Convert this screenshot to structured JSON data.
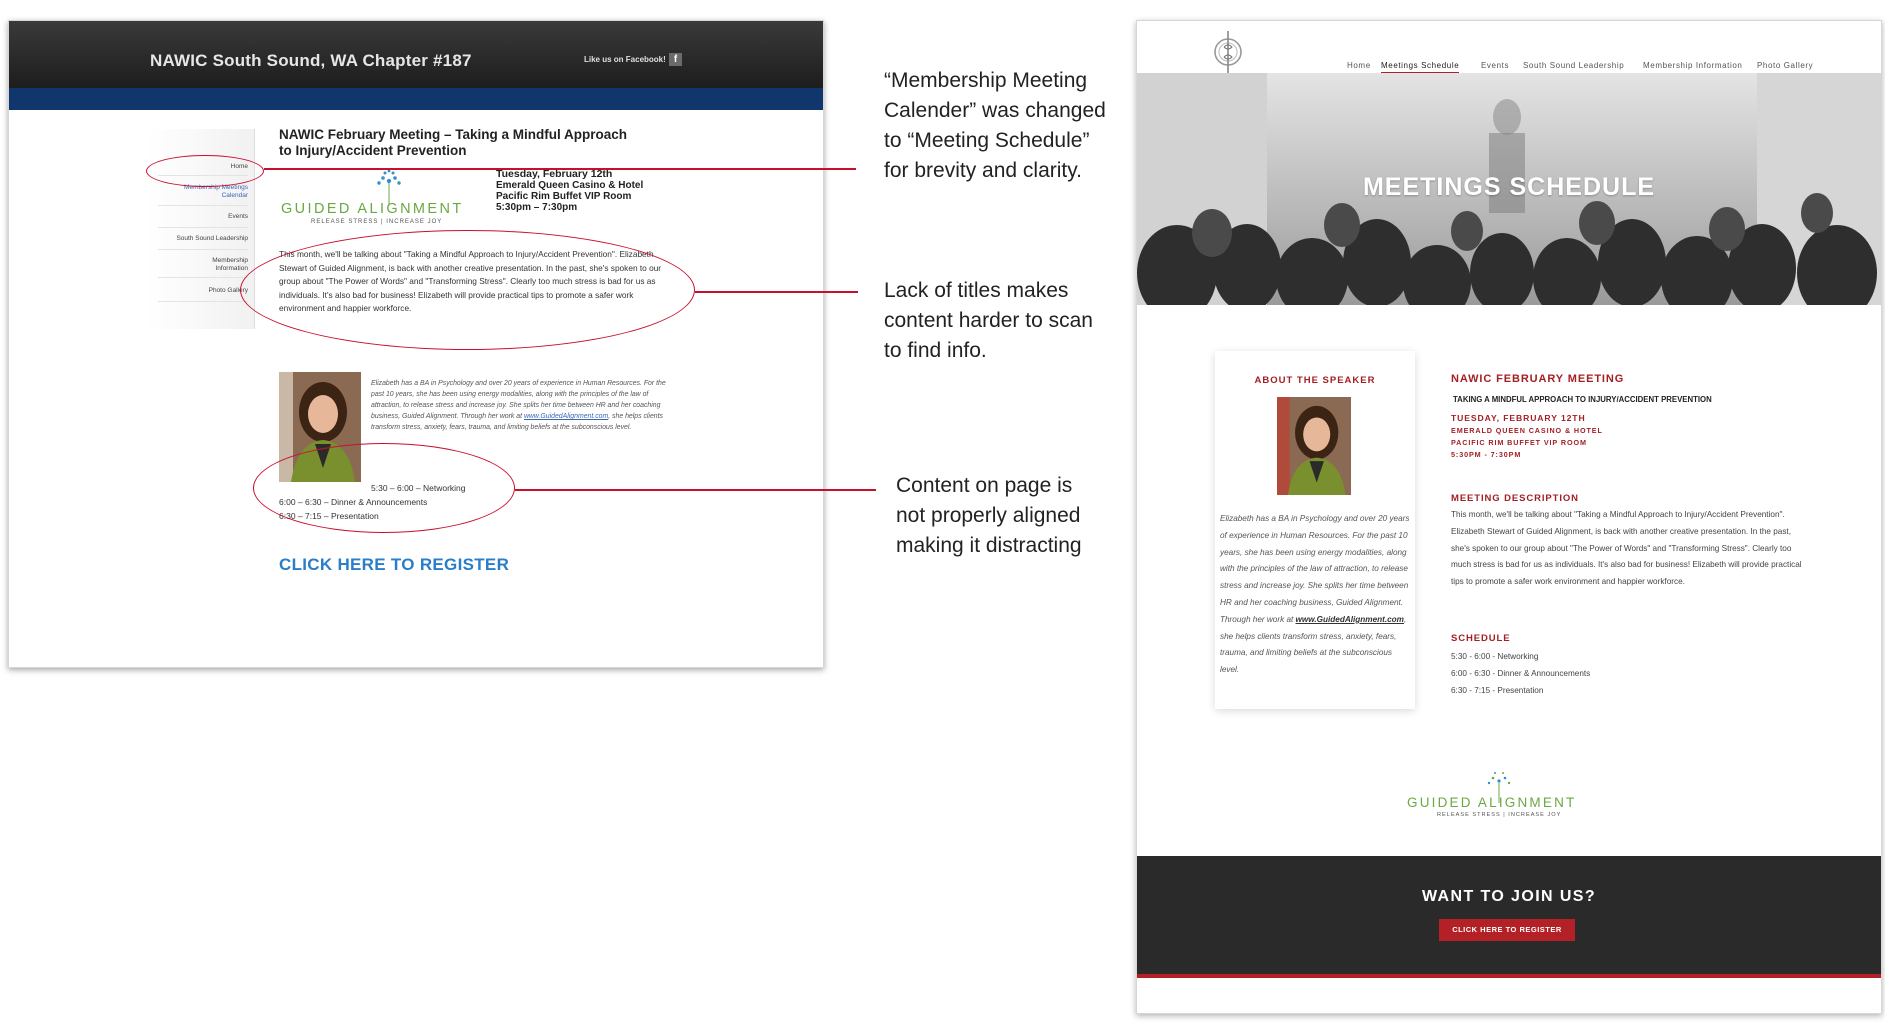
{
  "old_site": {
    "header_title": "NAWIC South Sound, WA Chapter #187",
    "facebook_label": "Like us on Facebook!",
    "facebook_icon": "f",
    "nav": [
      "Home",
      "Membership Meetings Calendar",
      "Events",
      "South Sound Leadership",
      "Membership Information",
      "Photo Gallery"
    ],
    "heading_line1": "NAWIC February Meeting – Taking a Mindful Approach",
    "heading_line2": "to Injury/Accident Prevention",
    "date_lines": [
      "Tuesday, February 12th",
      "Emerald Queen Casino & Hotel",
      "Pacific Rim Buffet VIP Room",
      "5:30pm – 7:30pm"
    ],
    "logo_text": "GUIDED ALIGNMENT",
    "logo_tagline": "RELEASE STRESS | INCREASE JOY",
    "description": "This month, we'll be talking about \"Taking a Mindful Approach to Injury/Accident Prevention\". Elizabeth Stewart of Guided Alignment, is back with another creative presentation. In the past, she's spoken to our group about \"The Power of Words\" and \"Transforming Stress\". Clearly too much stress is bad for us as individuals. It's also bad for business! Elizabeth will provide practical tips to promote a safer work environment and happier workforce.",
    "bio_before": "Elizabeth has a BA in Psychology and over 20 years of experience in Human Resources. For the past 10 years, she has been using energy modalities, along with the principles of the law of attraction, to release stress and increase joy. She splits her time between HR and her coaching business, Guided Alignment. Through her work at ",
    "bio_link": "www.GuidedAlignment.com",
    "bio_after": ", she helps clients transform stress, anxiety, fears, trauma, and limiting beliefs at the subconscious level.",
    "schedule": [
      "5:30 – 6:00 – Networking",
      "6:00 – 6:30 – Dinner & Announcements",
      "6:30 – 7:15 – Presentation"
    ],
    "register": "CLICK HERE TO REGISTER"
  },
  "annotations": {
    "note1": "“Membership Meeting Calender” was changed to “Meeting Schedule” for brevity and clarity.",
    "note2": "Lack of titles makes content harder to scan to find info.",
    "note3": "Content on page is not properly aligned making it distracting"
  },
  "new_site": {
    "nav": [
      "Home",
      "Meetings Schedule",
      "Events",
      "South Sound Leadership",
      "Membership Information",
      "Photo Gallery"
    ],
    "active_nav": "Meetings Schedule",
    "hero_title": "MEETINGS SCHEDULE",
    "about_heading": "ABOUT THE SPEAKER",
    "bio_before": "Elizabeth has a BA in Psychology and over 20 years of experience in Human Resources. For the past 10 years, she has been using energy modalities, along with the principles of the law of attraction, to release stress and increase joy. She splits her time between HR and her coaching business, Guided Alignment. Through her work at ",
    "bio_link": "www.GuidedAlignment.com",
    "bio_after": ", she helps clients transform stress, anxiety, fears, trauma, and limiting beliefs at the subconscious level.",
    "meeting_title": "NAWIC FEBRUARY MEETING",
    "meeting_subtitle": "TAKING A MINDFUL APPROACH TO INJURY/ACCIDENT PREVENTION",
    "date_lines": [
      "TUESDAY, FEBRUARY 12TH",
      "EMERALD QUEEN CASINO & HOTEL",
      "PACIFIC RIM BUFFET VIP ROOM",
      "5:30PM - 7:30PM"
    ],
    "desc_heading": "MEETING DESCRIPTION",
    "description": "This month, we'll be talking about \"Taking a Mindful Approach to Injury/Accident Prevention\". Elizabeth Stewart of Guided Alignment, is back with another creative presentation. In the past, she's spoken to our group about \"The Power of Words\" and \"Transforming Stress\". Clearly too much stress is bad for us as individuals. It's also bad for business! Elizabeth will provide practical tips to promote a safer work environment and happier workforce.",
    "schedule_heading": "SCHEDULE",
    "schedule": [
      "5:30 - 6:00 - Networking",
      "6:00 - 6:30 - Dinner & Announcements",
      "6:30 - 7:15 - Presentation"
    ],
    "logo_text": "GUIDED ALIGNMENT",
    "logo_tagline": "RELEASE STRESS | INCREASE JOY",
    "join_title": "WANT TO JOIN US?",
    "register_button": "CLICK HERE TO REGISTER"
  },
  "colors": {
    "annotation_red": "#c8102e",
    "old_blue_bar": "#10366b",
    "old_link_blue": "#2a7ec9",
    "new_accent_red": "#a31f24",
    "new_dark_band": "#2a2a2a",
    "logo_green": "#6aa842",
    "logo_blue": "#2f8fd0"
  },
  "icons": [
    "facebook-icon",
    "nawic-logo-icon",
    "guided-alignment-logo-icon",
    "speaker-photo"
  ]
}
